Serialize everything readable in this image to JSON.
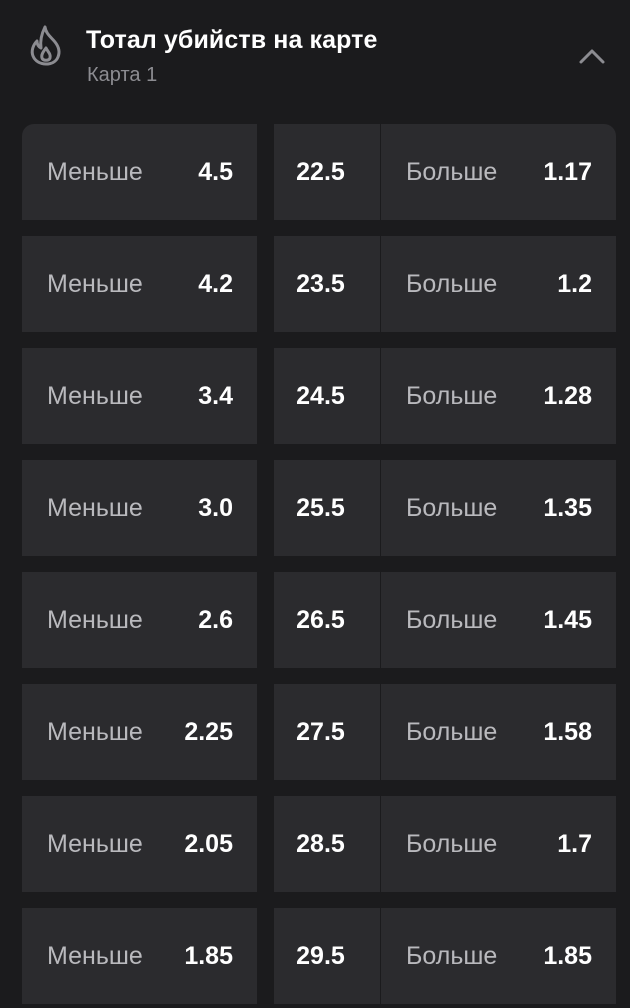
{
  "header": {
    "title": "Тотал убийств на карте",
    "subtitle": "Карта 1",
    "icon": "flame-icon",
    "collapse_icon": "chevron-up-icon"
  },
  "colors": {
    "background": "#1b1b1d",
    "cell": "#2b2b2e",
    "label": "#b9b9bd",
    "value": "#ffffff",
    "muted": "#8c8c91"
  },
  "market": {
    "rows": [
      {
        "under_label": "Меньше",
        "under_odds": "4.5",
        "line": "22.5",
        "over_label": "Больше",
        "over_odds": "1.17"
      },
      {
        "under_label": "Меньше",
        "under_odds": "4.2",
        "line": "23.5",
        "over_label": "Больше",
        "over_odds": "1.2"
      },
      {
        "under_label": "Меньше",
        "under_odds": "3.4",
        "line": "24.5",
        "over_label": "Больше",
        "over_odds": "1.28"
      },
      {
        "under_label": "Меньше",
        "under_odds": "3.0",
        "line": "25.5",
        "over_label": "Больше",
        "over_odds": "1.35"
      },
      {
        "under_label": "Меньше",
        "under_odds": "2.6",
        "line": "26.5",
        "over_label": "Больше",
        "over_odds": "1.45"
      },
      {
        "under_label": "Меньше",
        "under_odds": "2.25",
        "line": "27.5",
        "over_label": "Больше",
        "over_odds": "1.58"
      },
      {
        "under_label": "Меньше",
        "under_odds": "2.05",
        "line": "28.5",
        "over_label": "Больше",
        "over_odds": "1.7"
      },
      {
        "under_label": "Меньше",
        "under_odds": "1.85",
        "line": "29.5",
        "over_label": "Больше",
        "over_odds": "1.85"
      }
    ]
  }
}
